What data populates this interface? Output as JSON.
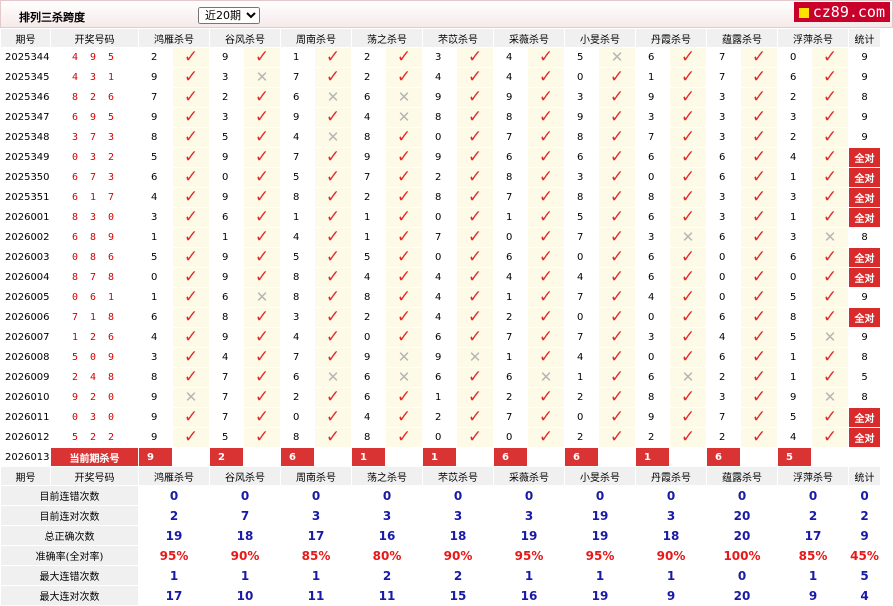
{
  "header": {
    "title": "排列三杀跨度",
    "period_select": "近20期",
    "site": "cz89.com"
  },
  "columns": {
    "period": "期号",
    "numbers": "开奖号码",
    "stat": "统计",
    "experts": [
      "鸿雁杀号",
      "谷风杀号",
      "周南杀号",
      "荡之杀号",
      "芣苡杀号",
      "采薇杀号",
      "小旻杀号",
      "丹霞杀号",
      "蕴露杀号",
      "浮萍杀号"
    ]
  },
  "rows": [
    {
      "period": "2025344",
      "numbers": "4 9 5",
      "kills": [
        "2",
        "9",
        "1",
        "2",
        "3",
        "4",
        "5",
        "6",
        "7",
        "0"
      ],
      "marks": [
        "ok",
        "ok",
        "ok",
        "ok",
        "ok",
        "ok",
        "no",
        "ok",
        "ok",
        "ok"
      ],
      "stat": "9",
      "all": false
    },
    {
      "period": "2025345",
      "numbers": "4 3 1",
      "kills": [
        "9",
        "3",
        "7",
        "2",
        "4",
        "4",
        "0",
        "1",
        "7",
        "6"
      ],
      "marks": [
        "ok",
        "no",
        "ok",
        "ok",
        "ok",
        "ok",
        "ok",
        "ok",
        "ok",
        "ok"
      ],
      "stat": "9",
      "all": false
    },
    {
      "period": "2025346",
      "numbers": "8 2 6",
      "kills": [
        "7",
        "2",
        "6",
        "6",
        "9",
        "9",
        "3",
        "9",
        "3",
        "2"
      ],
      "marks": [
        "ok",
        "ok",
        "no",
        "no",
        "ok",
        "ok",
        "ok",
        "ok",
        "ok",
        "ok"
      ],
      "stat": "8",
      "all": false
    },
    {
      "period": "2025347",
      "numbers": "6 9 5",
      "kills": [
        "9",
        "3",
        "9",
        "4",
        "8",
        "8",
        "9",
        "3",
        "3",
        "3"
      ],
      "marks": [
        "ok",
        "ok",
        "ok",
        "no",
        "ok",
        "ok",
        "ok",
        "ok",
        "ok",
        "ok"
      ],
      "stat": "9",
      "all": false
    },
    {
      "period": "2025348",
      "numbers": "3 7 3",
      "kills": [
        "8",
        "5",
        "4",
        "8",
        "0",
        "7",
        "8",
        "7",
        "3",
        "2"
      ],
      "marks": [
        "ok",
        "ok",
        "no",
        "ok",
        "ok",
        "ok",
        "ok",
        "ok",
        "ok",
        "ok"
      ],
      "stat": "9",
      "all": false
    },
    {
      "period": "2025349",
      "numbers": "0 3 2",
      "kills": [
        "5",
        "9",
        "7",
        "9",
        "9",
        "6",
        "6",
        "6",
        "6",
        "4"
      ],
      "marks": [
        "ok",
        "ok",
        "ok",
        "ok",
        "ok",
        "ok",
        "ok",
        "ok",
        "ok",
        "ok"
      ],
      "stat": "全对",
      "all": true
    },
    {
      "period": "2025350",
      "numbers": "6 7 3",
      "kills": [
        "6",
        "0",
        "5",
        "7",
        "2",
        "8",
        "3",
        "0",
        "6",
        "1"
      ],
      "marks": [
        "ok",
        "ok",
        "ok",
        "ok",
        "ok",
        "ok",
        "ok",
        "ok",
        "ok",
        "ok"
      ],
      "stat": "全对",
      "all": true
    },
    {
      "period": "2025351",
      "numbers": "6 1 7",
      "kills": [
        "4",
        "9",
        "8",
        "2",
        "8",
        "7",
        "8",
        "8",
        "3",
        "3"
      ],
      "marks": [
        "ok",
        "ok",
        "ok",
        "ok",
        "ok",
        "ok",
        "ok",
        "ok",
        "ok",
        "ok"
      ],
      "stat": "全对",
      "all": true
    },
    {
      "period": "2026001",
      "numbers": "8 3 0",
      "kills": [
        "3",
        "6",
        "1",
        "1",
        "0",
        "1",
        "5",
        "6",
        "3",
        "1"
      ],
      "marks": [
        "ok",
        "ok",
        "ok",
        "ok",
        "ok",
        "ok",
        "ok",
        "ok",
        "ok",
        "ok"
      ],
      "stat": "全对",
      "all": true
    },
    {
      "period": "2026002",
      "numbers": "6 8 9",
      "kills": [
        "1",
        "1",
        "4",
        "1",
        "7",
        "0",
        "7",
        "3",
        "6",
        "3"
      ],
      "marks": [
        "ok",
        "ok",
        "ok",
        "ok",
        "ok",
        "ok",
        "ok",
        "no",
        "ok",
        "no"
      ],
      "stat": "8",
      "all": false
    },
    {
      "period": "2026003",
      "numbers": "0 8 6",
      "kills": [
        "5",
        "9",
        "5",
        "5",
        "0",
        "6",
        "0",
        "6",
        "0",
        "6"
      ],
      "marks": [
        "ok",
        "ok",
        "ok",
        "ok",
        "ok",
        "ok",
        "ok",
        "ok",
        "ok",
        "ok"
      ],
      "stat": "全对",
      "all": true
    },
    {
      "period": "2026004",
      "numbers": "8 7 8",
      "kills": [
        "0",
        "9",
        "8",
        "4",
        "4",
        "4",
        "4",
        "6",
        "0",
        "0"
      ],
      "marks": [
        "ok",
        "ok",
        "ok",
        "ok",
        "ok",
        "ok",
        "ok",
        "ok",
        "ok",
        "ok"
      ],
      "stat": "全对",
      "all": true
    },
    {
      "period": "2026005",
      "numbers": "0 6 1",
      "kills": [
        "1",
        "6",
        "8",
        "8",
        "4",
        "1",
        "7",
        "4",
        "0",
        "5"
      ],
      "marks": [
        "ok",
        "no",
        "ok",
        "ok",
        "ok",
        "ok",
        "ok",
        "ok",
        "ok",
        "ok"
      ],
      "stat": "9",
      "all": false
    },
    {
      "period": "2026006",
      "numbers": "7 1 8",
      "kills": [
        "6",
        "8",
        "3",
        "2",
        "4",
        "2",
        "0",
        "0",
        "6",
        "8"
      ],
      "marks": [
        "ok",
        "ok",
        "ok",
        "ok",
        "ok",
        "ok",
        "ok",
        "ok",
        "ok",
        "ok"
      ],
      "stat": "全对",
      "all": true
    },
    {
      "period": "2026007",
      "numbers": "1 2 6",
      "kills": [
        "4",
        "9",
        "4",
        "0",
        "6",
        "7",
        "7",
        "3",
        "4",
        "5"
      ],
      "marks": [
        "ok",
        "ok",
        "ok",
        "ok",
        "ok",
        "ok",
        "ok",
        "ok",
        "ok",
        "no"
      ],
      "stat": "9",
      "all": false
    },
    {
      "period": "2026008",
      "numbers": "5 0 9",
      "kills": [
        "3",
        "4",
        "7",
        "9",
        "9",
        "1",
        "4",
        "0",
        "6",
        "1"
      ],
      "marks": [
        "ok",
        "ok",
        "ok",
        "no",
        "no",
        "ok",
        "ok",
        "ok",
        "ok",
        "ok"
      ],
      "stat": "8",
      "all": false
    },
    {
      "period": "2026009",
      "numbers": "2 4 8",
      "kills": [
        "8",
        "7",
        "6",
        "6",
        "6",
        "6",
        "1",
        "6",
        "2",
        "1"
      ],
      "marks": [
        "ok",
        "ok",
        "no",
        "no",
        "ok",
        "no",
        "ok",
        "no",
        "ok",
        "ok"
      ],
      "stat": "5",
      "all": false
    },
    {
      "period": "2026010",
      "numbers": "9 2 0",
      "kills": [
        "9",
        "7",
        "2",
        "6",
        "1",
        "2",
        "2",
        "8",
        "3",
        "9"
      ],
      "marks": [
        "no",
        "ok",
        "ok",
        "ok",
        "ok",
        "ok",
        "ok",
        "ok",
        "ok",
        "no"
      ],
      "stat": "8",
      "all": false
    },
    {
      "period": "2026011",
      "numbers": "0 3 0",
      "kills": [
        "9",
        "7",
        "0",
        "4",
        "2",
        "7",
        "0",
        "9",
        "7",
        "5"
      ],
      "marks": [
        "ok",
        "ok",
        "ok",
        "ok",
        "ok",
        "ok",
        "ok",
        "ok",
        "ok",
        "ok"
      ],
      "stat": "全对",
      "all": true
    },
    {
      "period": "2026012",
      "numbers": "5 2 2",
      "kills": [
        "9",
        "5",
        "8",
        "8",
        "0",
        "0",
        "2",
        "2",
        "2",
        "4"
      ],
      "marks": [
        "ok",
        "ok",
        "ok",
        "ok",
        "ok",
        "ok",
        "ok",
        "ok",
        "ok",
        "ok"
      ],
      "stat": "全对",
      "all": true
    }
  ],
  "current": {
    "period": "2026013",
    "label": "当前期杀号",
    "kills": [
      "9",
      "2",
      "6",
      "1",
      "1",
      "6",
      "6",
      "1",
      "6",
      "5"
    ]
  },
  "stats": [
    {
      "label": "目前连错次数",
      "values": [
        "0",
        "0",
        "0",
        "0",
        "0",
        "0",
        "0",
        "0",
        "0",
        "0",
        "0"
      ],
      "rate": false
    },
    {
      "label": "目前连对次数",
      "values": [
        "2",
        "7",
        "3",
        "3",
        "3",
        "3",
        "19",
        "3",
        "20",
        "2",
        "2"
      ],
      "rate": false
    },
    {
      "label": "总正确次数",
      "values": [
        "19",
        "18",
        "17",
        "16",
        "18",
        "19",
        "19",
        "18",
        "20",
        "17",
        "9"
      ],
      "rate": false
    },
    {
      "label": "准确率(全对率)",
      "values": [
        "95%",
        "90%",
        "85%",
        "80%",
        "90%",
        "95%",
        "95%",
        "90%",
        "100%",
        "85%",
        "45%"
      ],
      "rate": true
    },
    {
      "label": "最大连错次数",
      "values": [
        "1",
        "1",
        "1",
        "2",
        "2",
        "1",
        "1",
        "1",
        "0",
        "1",
        "5"
      ],
      "rate": false
    },
    {
      "label": "最大连对次数",
      "values": [
        "17",
        "10",
        "11",
        "11",
        "15",
        "16",
        "19",
        "9",
        "20",
        "9",
        "4"
      ],
      "rate": false
    }
  ],
  "glyphs": {
    "ok": "✓",
    "no": "✕"
  },
  "colors": {
    "accent": "#d92b2b",
    "stat_blue": "#1a1aaa",
    "rate_red": "#e81818",
    "mark_bg": "#fdfbe8"
  }
}
